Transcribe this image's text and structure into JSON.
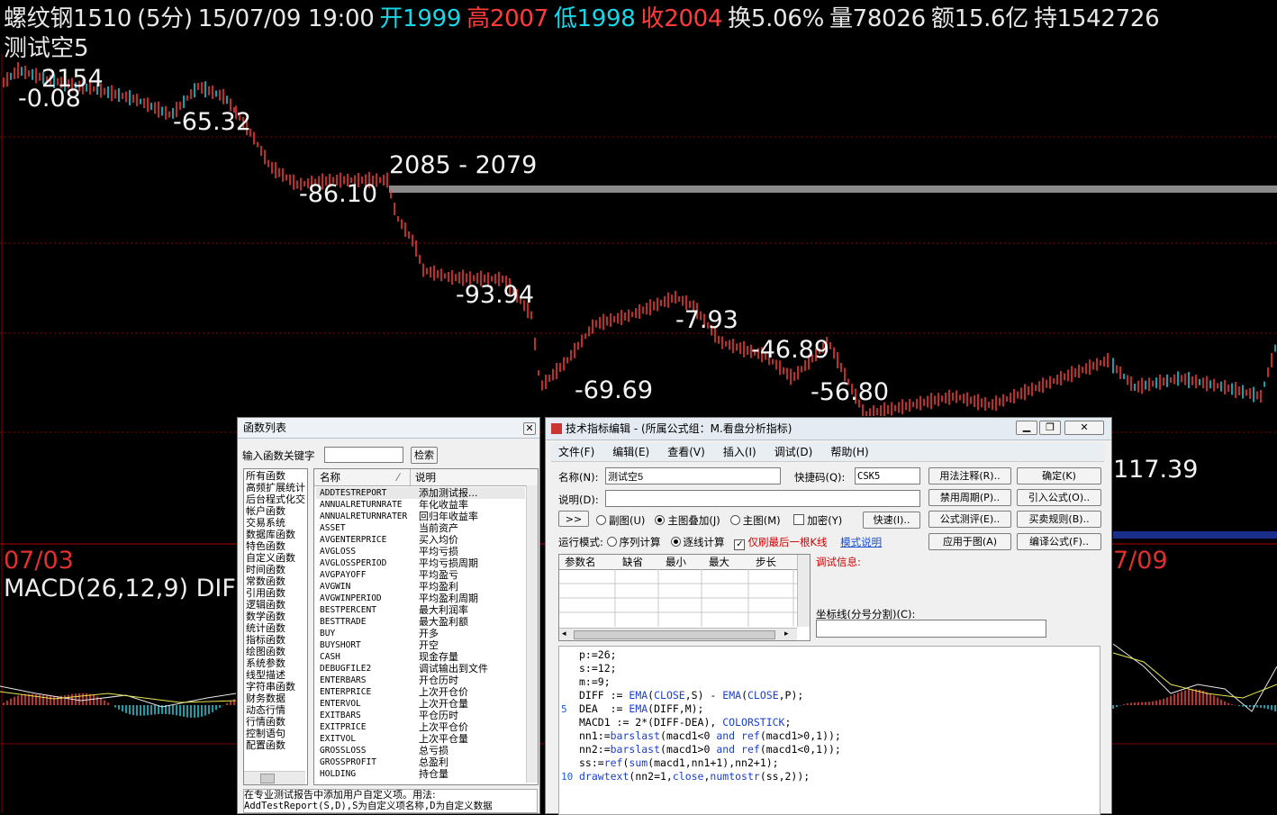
{
  "header": {
    "name": "螺纹钢1510",
    "period": "(5分)",
    "datetime": "15/07/09 19:00",
    "open": "开1999",
    "high": "高2007",
    "low": "低1998",
    "close": "收2004",
    "turnover": "换5.06%",
    "volume": "量78026",
    "amount": "额15.6亿",
    "hold": "持1542726"
  },
  "indicator_name": "测试空5",
  "chart_labels": {
    "l1": "2154",
    "l2": "-0.08",
    "l3": "-65.32",
    "l4": "2085 - 2079",
    "l5": "-86.10",
    "l6": "-93.94",
    "l7": "-7.93",
    "l8": "-46.89",
    "l9": "-69.69",
    "l10": "-56.80",
    "l11": "117.39"
  },
  "dates": {
    "left": "07/03",
    "right": "7/09"
  },
  "macd_title": "MACD(26,12,9) DIF",
  "func_dialog": {
    "title": "函数列表",
    "search_label": "输入函数关键字",
    "search_value": "",
    "search_button": "检索",
    "categories": [
      "所有函数",
      "高频扩展统计",
      "后台程式化交",
      "帐户函数",
      "交易系统",
      "数据库函数",
      "特色函数",
      "自定义函数",
      "时间函数",
      "常数函数",
      "引用函数",
      "逻辑函数",
      "数学函数",
      "统计函数",
      "指标函数",
      "绘图函数",
      "系统参数",
      "线型描述",
      "字符串函数",
      "财务数据",
      "动态行情",
      "行情函数",
      "控制语句",
      "配置函数"
    ],
    "col_name": "名称",
    "col_desc": "说明",
    "functions": [
      {
        "name": "ADDTESTREPORT",
        "desc": "添加测试报..."
      },
      {
        "name": "ANNUALRETURNRATE",
        "desc": "年化收益率"
      },
      {
        "name": "ANNUALRETURNRATER",
        "desc": "回归年收益率"
      },
      {
        "name": "ASSET",
        "desc": "当前资产"
      },
      {
        "name": "AVGENTERPRICE",
        "desc": "买入均价"
      },
      {
        "name": "AVGLOSS",
        "desc": "平均亏损"
      },
      {
        "name": "AVGLOSSPERIOD",
        "desc": "平均亏损周期"
      },
      {
        "name": "AVGPAYOFF",
        "desc": "平均盈亏"
      },
      {
        "name": "AVGWIN",
        "desc": "平均盈利"
      },
      {
        "name": "AVGWINPERIOD",
        "desc": "平均盈利周期"
      },
      {
        "name": "BESTPERCENT",
        "desc": "最大利润率"
      },
      {
        "name": "BESTTRADE",
        "desc": "最大盈利额"
      },
      {
        "name": "BUY",
        "desc": "开多"
      },
      {
        "name": "BUYSHORT",
        "desc": "开空"
      },
      {
        "name": "CASH",
        "desc": "现金存量"
      },
      {
        "name": "DEBUGFILE2",
        "desc": "调试输出到文件"
      },
      {
        "name": "ENTERBARS",
        "desc": "开仓历时"
      },
      {
        "name": "ENTERPRICE",
        "desc": "上次开仓价"
      },
      {
        "name": "ENTERVOL",
        "desc": "上次开仓量"
      },
      {
        "name": "EXITBARS",
        "desc": "平仓历时"
      },
      {
        "name": "EXITPRICE",
        "desc": "上次平仓价"
      },
      {
        "name": "EXITVOL",
        "desc": "上次平仓量"
      },
      {
        "name": "GROSSLOSS",
        "desc": "总亏损"
      },
      {
        "name": "GROSSPROFIT",
        "desc": "总盈利"
      },
      {
        "name": "HOLDING",
        "desc": "持仓量"
      }
    ],
    "footer_line1": "在专业测试报告中添加用户自定义项。用法:",
    "footer_line2": "AddTestReport(S,D),S为自定义项名称,D为自定义数据"
  },
  "editor": {
    "title": "技术指标编辑 - (所属公式组：M.看盘分析指标)",
    "menu": [
      "文件(F)",
      "编辑(E)",
      "查看(V)",
      "插入(I)",
      "调试(D)",
      "帮助(H)"
    ],
    "name_label": "名称(N):",
    "name_value": "测试空5",
    "shortcut_label": "快捷码(Q):",
    "shortcut_value": "CSK5",
    "desc_label": "说明(D):",
    "desc_value": "",
    "btn_usage": "用法注释(R)..",
    "btn_ok": "确定(K)",
    "btn_disable": "禁用周期(P)..",
    "btn_import": "引入公式(O)..",
    "btn_eval": "公式测评(E)..",
    "btn_rule": "买卖规则(B)..",
    "btn_apply": "应用于图(A)",
    "btn_compile": "编译公式(F)..",
    "btn_expand": ">>",
    "radio_sub": "副图(U)",
    "radio_overlay": "主图叠加(J)",
    "radio_main": "主图(M)",
    "check_encrypt": "加密(Y)",
    "btn_fast": "快速(I)..",
    "run_mode_label": "运行模式:",
    "radio_seq": "序列计算",
    "radio_step": "逐线计算",
    "check_lastbar": "仅刷最后一根K线",
    "link_mode": "模式说明",
    "param_headers": [
      "参数名",
      "缺省",
      "最小",
      "最大",
      "步长"
    ],
    "debug_label": "调试信息:",
    "coord_label": "坐标线(分号分割)(C):",
    "code_lines": [
      "p:=26;",
      "s:=12;",
      "m:=9;",
      "DIFF := EMA(CLOSE,S) - EMA(CLOSE,P);",
      "DEA  := EMA(DIFF,M);",
      "MACD1 := 2*(DIFF-DEA), COLORSTICK;",
      "nn1:=barslast(macd1<0 and ref(macd1>0,1));",
      "nn2:=barslast(macd1>0 and ref(macd1<0,1));",
      "ss:=ref(sum(macd1,nn1+1),nn2+1);",
      "drawtext(nn2=1,close,numtostr(ss,2));"
    ],
    "line_marks": [
      "5",
      "10"
    ]
  }
}
